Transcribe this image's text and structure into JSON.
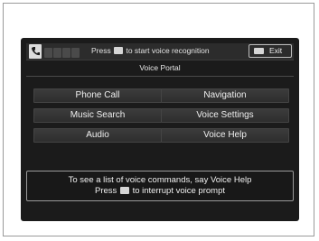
{
  "header": {
    "prompt_before": "Press",
    "prompt_after": "to start voice recognition",
    "exit_label": "Exit"
  },
  "portal_title": "Voice Portal",
  "menu": {
    "phone_call": "Phone Call",
    "navigation": "Navigation",
    "music_search": "Music Search",
    "voice_settings": "Voice Settings",
    "audio": "Audio",
    "voice_help": "Voice Help"
  },
  "footer": {
    "line1": "To see a list of voice commands, say Voice Help",
    "line2_before": "Press",
    "line2_after": "to interrupt voice prompt"
  },
  "icons": [
    "phone-icon",
    "signal-bars-icon",
    "talk-icon",
    "back-icon"
  ]
}
